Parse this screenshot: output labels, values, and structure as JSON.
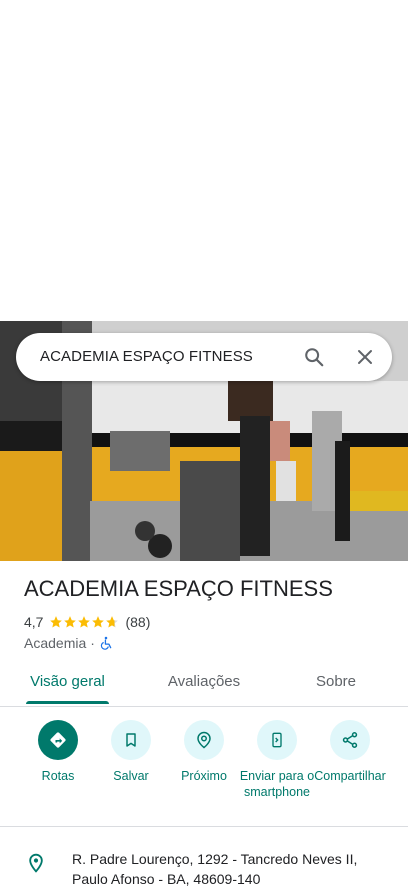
{
  "search": {
    "query": "ACADEMIA ESPAÇO FITNESS",
    "search_icon": "search-icon",
    "close_icon": "close-icon"
  },
  "place": {
    "name": "ACADEMIA ESPAÇO FITNESS",
    "rating": "4,7",
    "stars": 4.7,
    "review_count": "(88)",
    "category": "Academia",
    "separator": "·",
    "accessibility_icon": "wheelchair-icon"
  },
  "tabs": [
    {
      "label": "Visão geral",
      "active": true
    },
    {
      "label": "Avaliações",
      "active": false
    },
    {
      "label": "Sobre",
      "active": false
    }
  ],
  "actions": [
    {
      "label": "Rotas",
      "icon": "directions-icon"
    },
    {
      "label": "Salvar",
      "icon": "bookmark-icon"
    },
    {
      "label": "Próximo",
      "icon": "nearby-icon"
    },
    {
      "label": "Enviar para o smartphone",
      "icon": "send-to-phone-icon"
    },
    {
      "label": "Compartilhar",
      "icon": "share-icon"
    }
  ],
  "address": {
    "icon": "location-pin-icon",
    "text": "R. Padre Lourenço, 1292 - Tancredo Neves II, Paulo Afonso - BA, 48609-140"
  },
  "colors": {
    "accent": "#00796b",
    "star": "#fbbc04",
    "chip_bg": "#e0f7fa"
  }
}
